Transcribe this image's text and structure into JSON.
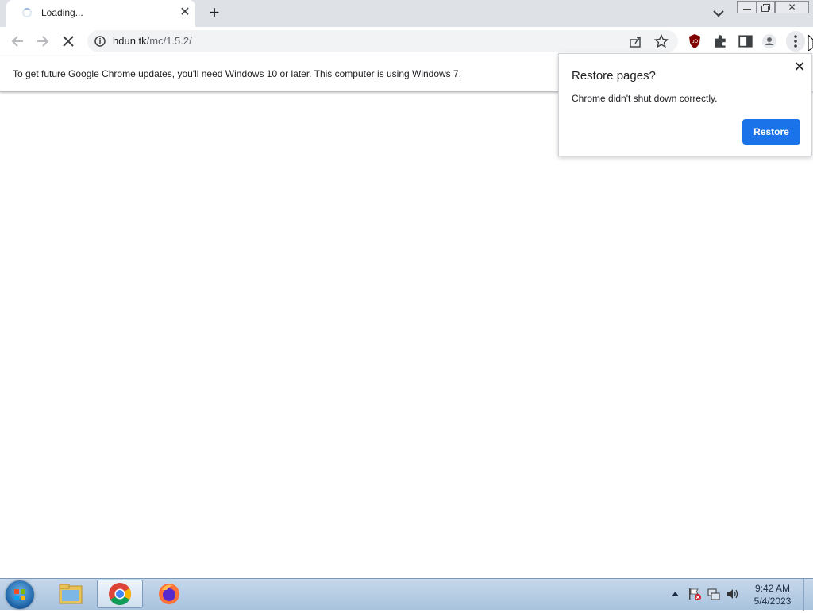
{
  "browser": {
    "tab": {
      "title": "Loading...",
      "close_icon": "close-icon",
      "loading_icon": "spinner-icon"
    },
    "new_tab_icon": "plus-icon",
    "toolbar": {
      "url_host": "hdun.tk",
      "url_path": "/mc/1.5.2/",
      "icons": [
        "back-arrow-icon",
        "forward-arrow-icon",
        "stop-icon",
        "info-icon",
        "share-icon",
        "star-icon",
        "ublock-icon",
        "puzzle-icon",
        "side-panel-icon",
        "profile-icon",
        "kebab-menu-icon"
      ]
    },
    "infobar": {
      "message": "To get future Google Chrome updates, you'll need Windows 10 or later. This computer is using Windows 7."
    },
    "restore_popup": {
      "title": "Restore pages?",
      "body": "Chrome didn't shut down correctly.",
      "button": "Restore",
      "accent": "#1a73e8"
    }
  },
  "taskbar": {
    "apps": [
      "explorer-icon",
      "chrome-icon",
      "firefox-icon"
    ],
    "clock": {
      "time": "9:42 AM",
      "date": "5/4/2023"
    }
  }
}
